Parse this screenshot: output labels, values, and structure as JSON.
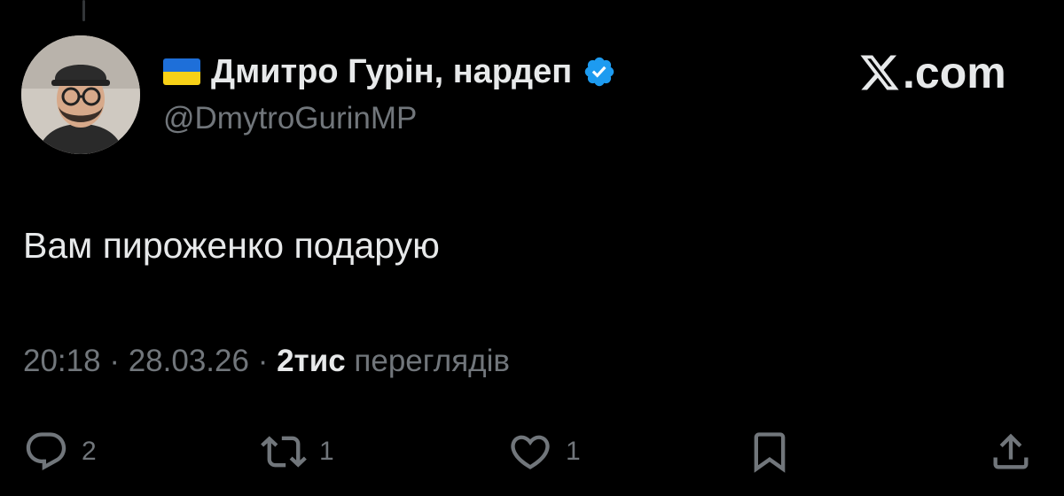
{
  "author": {
    "display_name": "Дмитро Гурін, нардеп",
    "handle": "@DmytroGurinMP",
    "flag_icon": "ukraine-flag-icon",
    "verified_icon": "verified-badge-icon",
    "verified_color": "#1d9bf0"
  },
  "brand": {
    "logo_icon": "x-logo-icon",
    "domain_suffix": ".com"
  },
  "tweet": {
    "text": "Вам пироженко подарую",
    "time": "20:18",
    "date": "28.03.26",
    "views_count": "2тис",
    "views_label": "переглядів",
    "separator": "·"
  },
  "actions": {
    "reply": {
      "icon": "reply-icon",
      "count": "2"
    },
    "retweet": {
      "icon": "retweet-icon",
      "count": "1"
    },
    "like": {
      "icon": "heart-icon",
      "count": "1"
    },
    "bookmark": {
      "icon": "bookmark-icon"
    },
    "share": {
      "icon": "share-icon"
    }
  },
  "colors": {
    "background": "#000000",
    "primary_text": "#e7e9ea",
    "secondary_text": "#71767b",
    "accent": "#1d9bf0"
  }
}
